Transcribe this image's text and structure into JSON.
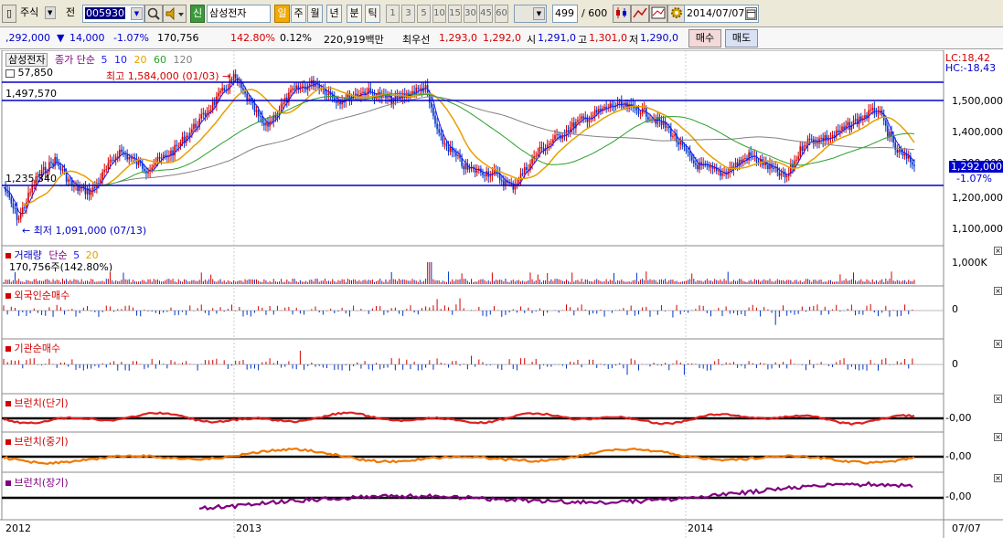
{
  "toolbar": {
    "market_type": "주식",
    "market_view": "전",
    "stock_code": "005930",
    "stock_badge": "신",
    "stock_name": "삼성전자",
    "period_tabs": [
      "일",
      "주",
      "월",
      "년",
      "분",
      "틱"
    ],
    "active_period": "일",
    "interval_buttons": [
      "1",
      "3",
      "5",
      "10",
      "15",
      "30",
      "45",
      "60"
    ],
    "count_value": "499",
    "count_total": "/ 600",
    "date_value": "2014/07/07"
  },
  "quote": {
    "price": ",292,000",
    "change_arrow": "▼",
    "change": "14,000",
    "change_pct": "-1.07%",
    "volume": "170,756",
    "volume_pct": "142.80%",
    "turnover_pct": "0.12%",
    "amount": "220,919백만",
    "best_ask_label": "최우선",
    "best_ask": "1,293,0",
    "best_bid": "1,292,0",
    "open_label": "시",
    "open": "1,291,0",
    "high_label": "고",
    "high": "1,301,0",
    "low_label": "저",
    "low": "1,290,0",
    "buy_label": "매수",
    "sell_label": "매도"
  },
  "price_panel": {
    "stock_name": "삼성전자",
    "ma_label": "종가 단순",
    "ma_periods": [
      "5",
      "10",
      "20",
      "60",
      "120"
    ],
    "ma_colors": [
      "#1a1aff",
      "#1a1aff",
      "#e6a000",
      "#2aa02a",
      "#808080"
    ],
    "corner_value": "57,850",
    "lc_value": "LC:18,42",
    "hc_value": "HC:-18,43",
    "high_annotation": "최고 1,584,000 (01/03)",
    "low_annotation": "최저 1,091,000 (07/13)",
    "line1_label": "1,497,570",
    "line2_label": "1,235,340",
    "current_price": "1,292,000",
    "current_change": "-1.07%",
    "y_axis_ticks": [
      "1,500,000",
      "1,400,000",
      "1,300,000",
      "1,200,000",
      "1,100,000"
    ]
  },
  "volume_panel": {
    "title": "거래량",
    "ma_label": "단순",
    "ma_periods": [
      "5",
      "20"
    ],
    "volume_text": "170,756주(142.80%)",
    "y_axis_tick": "1,000K"
  },
  "foreign_panel": {
    "title": "외국인순매수",
    "zero_label": "0"
  },
  "institution_panel": {
    "title": "기관순매수",
    "zero_label": "0"
  },
  "branch_short": {
    "title": "브런치(단기)",
    "level_label": "0,00"
  },
  "branch_mid": {
    "title": "브런치(중기)",
    "level_label": "0,00"
  },
  "branch_long": {
    "title": "브런치(장기)",
    "level_label": "0,00"
  },
  "x_axis": {
    "labels": [
      "2012",
      "2013",
      "2014"
    ],
    "right_label": "07/07"
  },
  "colors": {
    "up": "#d40000",
    "down": "#0033cc",
    "ma5": "#1a1aff",
    "ma20": "#e6a000",
    "ma60": "#2aa02a",
    "ma120": "#808080",
    "hline": "#0000cc",
    "branch_short": "#e02020",
    "branch_mid": "#f07800",
    "branch_long": "#800080"
  }
}
